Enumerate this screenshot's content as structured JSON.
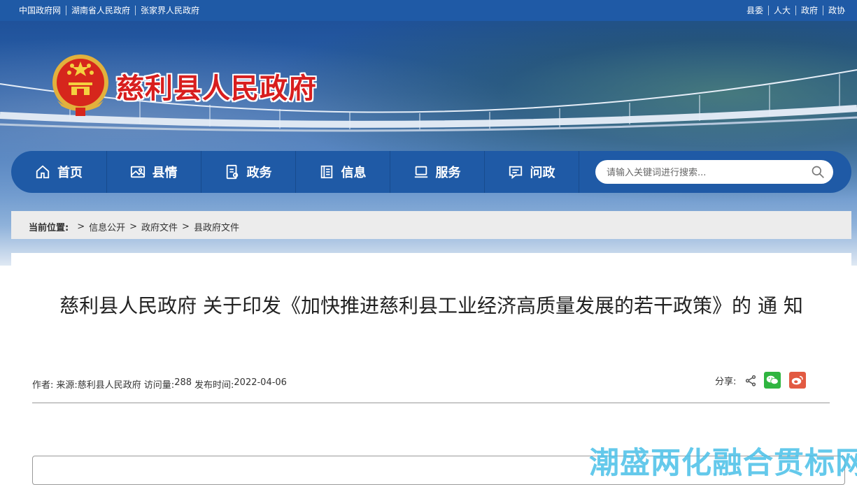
{
  "topbar": {
    "left_links": [
      "中国政府网",
      "湖南省人民政府",
      "张家界人民政府"
    ],
    "right_links": [
      "县委",
      "人大",
      "政府",
      "政协"
    ]
  },
  "site": {
    "title": "慈利县人民政府"
  },
  "nav": {
    "items": [
      {
        "label": "首页",
        "icon": "home-icon"
      },
      {
        "label": "县情",
        "icon": "picture-icon"
      },
      {
        "label": "政务",
        "icon": "document-icon"
      },
      {
        "label": "信息",
        "icon": "info-list-icon"
      },
      {
        "label": "服务",
        "icon": "laptop-icon"
      },
      {
        "label": "问政",
        "icon": "message-icon"
      }
    ],
    "search_placeholder": "请输入关键词进行搜索..."
  },
  "breadcrumb": {
    "label": "当前位置:",
    "items": [
      "信息公开",
      "政府文件",
      "县政府文件"
    ]
  },
  "article": {
    "title": "慈利县人民政府 关于印发《加快推进慈利县工业经济高质量发展的若干政策》的 通 知",
    "meta": {
      "author_label": "作者:",
      "source_label": "来源:",
      "source_value": "慈利县人民政府",
      "visits_label": "访问量:",
      "visits_value": "288",
      "date_label": "发布时间:",
      "date_value": "2022-04-06"
    },
    "share_label": "分享:"
  },
  "watermark": "潮盛两化融合贯标网",
  "colors": {
    "primary": "#1f5aa6",
    "title_red": "#d81e1e",
    "wechat": "#2fb540",
    "weibo": "#e25a42"
  }
}
